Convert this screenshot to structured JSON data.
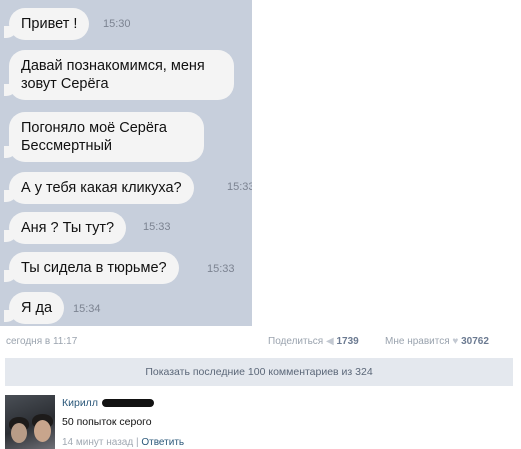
{
  "messages": [
    {
      "text": "Привет !",
      "time": "15:30"
    },
    {
      "text": "Давай познакомимся, меня зовут Серёга",
      "time": ""
    },
    {
      "text": "Погоняло моё Серёга Бессмертный",
      "time": ""
    },
    {
      "text": "А у тебя какая кликуха?",
      "time": "15:33"
    },
    {
      "text": "Аня ? Ты тут?",
      "time": "15:33"
    },
    {
      "text": "Ты сидела в тюрьме?",
      "time": "15:33"
    },
    {
      "text": "Я да",
      "time": "15:34"
    }
  ],
  "post": {
    "date": "сегодня в 11:17",
    "share_label": "Поделиться",
    "share_count": "1739",
    "like_label": "Мне нравится",
    "like_count": "30762"
  },
  "comments": {
    "show_all_label": "Показать последние 100 комментариев из 324",
    "items": [
      {
        "author": "Кирилл",
        "text": "50 попыток серого",
        "time": "14 минут назад",
        "reply_label": "Ответить"
      }
    ]
  }
}
